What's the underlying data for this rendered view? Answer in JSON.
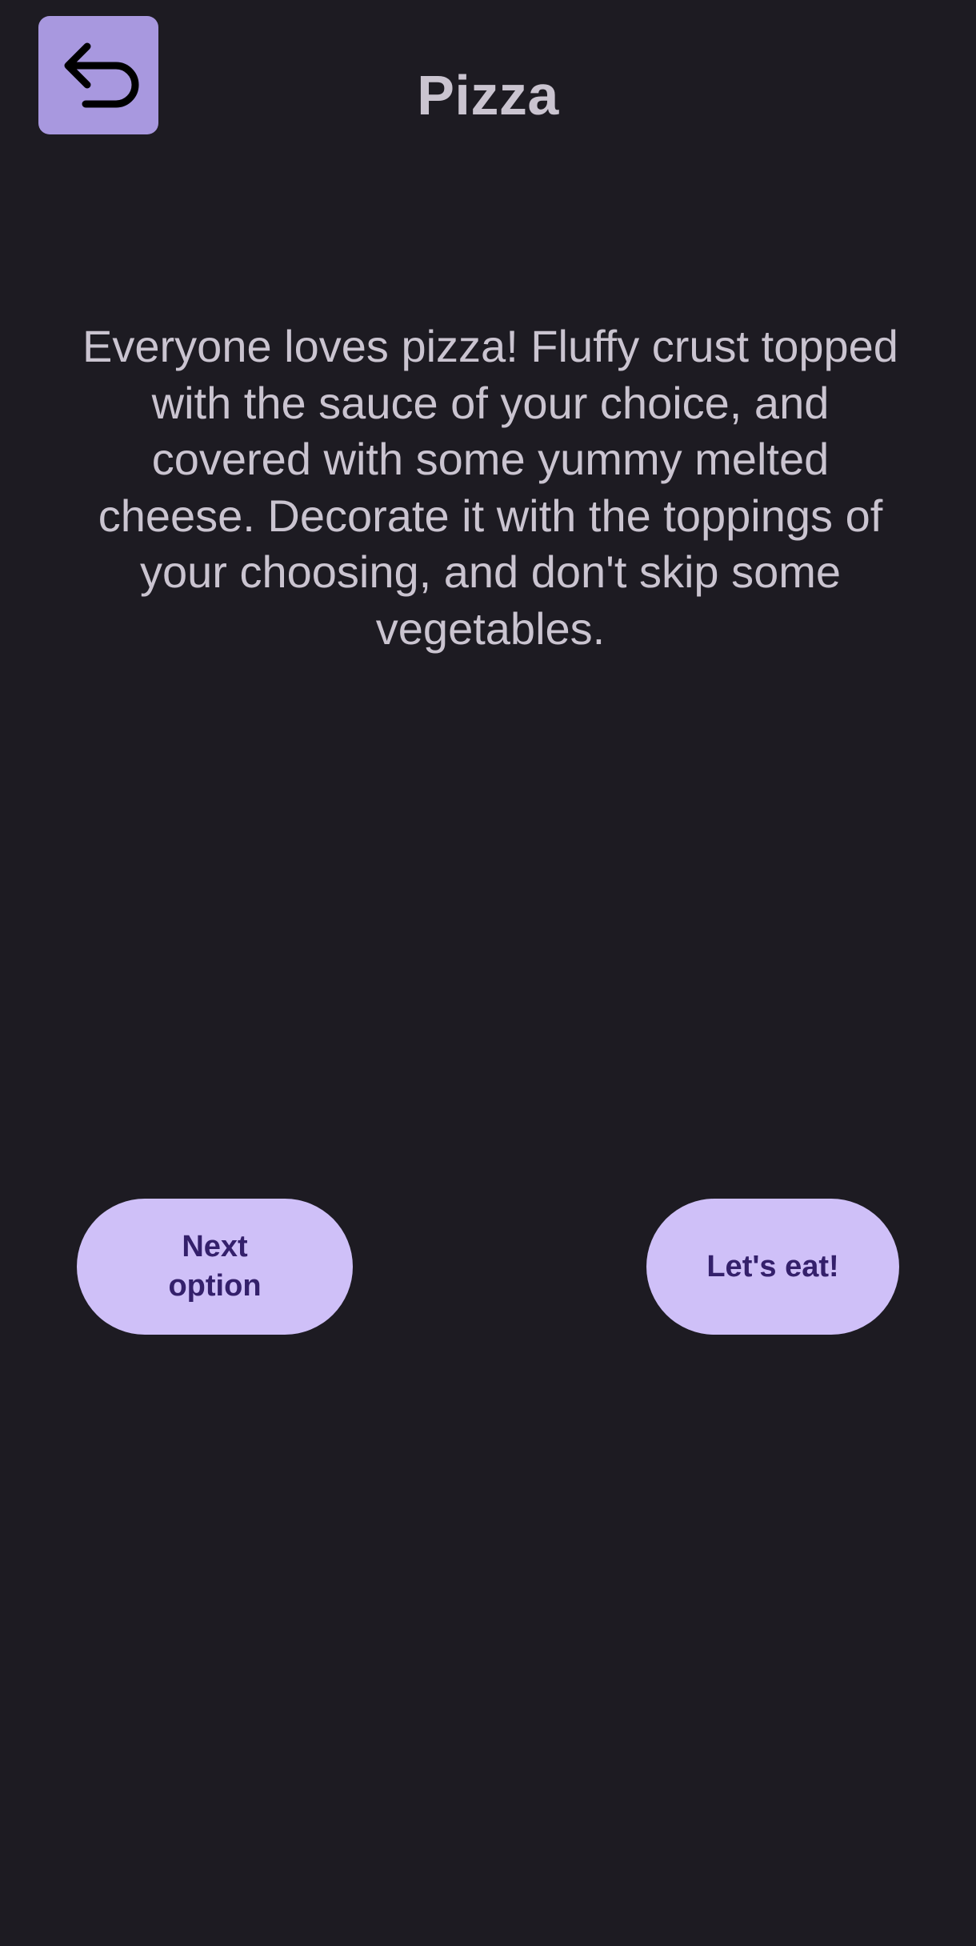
{
  "header": {
    "title": "Pizza",
    "back_icon": "back-arrow-icon"
  },
  "main": {
    "description": "Everyone loves pizza! Fluffy crust topped with the sauce of your choice, and covered with some yummy melted cheese. Decorate it with the toppings of your choosing, and don't skip some vegetables."
  },
  "actions": {
    "next_label": "Next option",
    "eat_label": "Let's eat!"
  },
  "colors": {
    "background": "#1d1b22",
    "back_button": "#a898df",
    "pill_button": "#cfc0f8",
    "pill_text": "#34206b",
    "text": "#cac4d0"
  }
}
